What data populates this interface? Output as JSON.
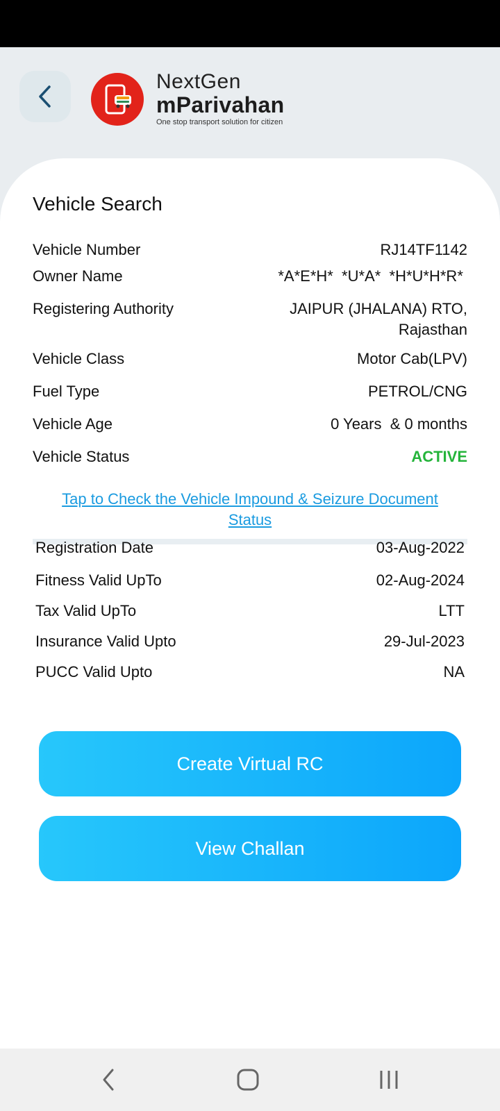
{
  "header": {
    "brand_top": "NextGen",
    "brand_main": "mParivahan",
    "tagline": "One stop transport solution for citizen"
  },
  "card": {
    "title": "Vehicle Search",
    "details": [
      {
        "label": "Vehicle Number",
        "value": "RJ14TF1142"
      },
      {
        "label": "Owner Name",
        "value": "*A*E*H*  *U*A*  *H*U*H*R* "
      },
      {
        "label": "Registering Authority",
        "value_line1": "JAIPUR (JHALANA) RTO,",
        "value_line2": "Rajasthan"
      },
      {
        "label": "Vehicle Class",
        "value": "Motor Cab(LPV)"
      },
      {
        "label": "Fuel Type",
        "value": "PETROL/CNG"
      },
      {
        "label": "Vehicle Age",
        "value": "0 Years  & 0 months"
      },
      {
        "label": "Vehicle Status",
        "value": "ACTIVE"
      }
    ],
    "impound_link_line1": "Tap to Check the Vehicle Impound & Seizure Document",
    "impound_link_line2": "Status",
    "validity": [
      {
        "label": "Registration Date",
        "value": "03-Aug-2022"
      },
      {
        "label": "Fitness Valid UpTo",
        "value": "02-Aug-2024"
      },
      {
        "label": "Tax Valid UpTo",
        "value": "LTT"
      },
      {
        "label": "Insurance Valid Upto",
        "value": "29-Jul-2023"
      },
      {
        "label": "PUCC Valid Upto",
        "value": "NA"
      }
    ]
  },
  "buttons": {
    "virtual_rc": "Create Virtual RC",
    "challan": "View Challan"
  },
  "colors": {
    "status_active": "#25b43b",
    "link": "#1a9be0",
    "button_gradient_start": "#27c7fb",
    "button_gradient_end": "#0ca6fb",
    "logo_red": "#e2231a"
  },
  "icons": {
    "back": "chevron-left-icon",
    "logo": "mparivahan-logo",
    "nav_back": "nav-back-icon",
    "nav_home": "nav-home-icon",
    "nav_recents": "nav-recents-icon"
  }
}
